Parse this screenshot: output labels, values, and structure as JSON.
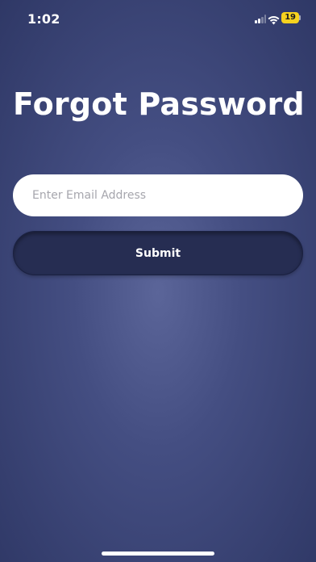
{
  "status_bar": {
    "time": "1:02",
    "battery_level": "19",
    "icons": [
      "signal-icon",
      "wifi-icon",
      "battery-icon"
    ]
  },
  "page": {
    "title": "Forgot Password"
  },
  "form": {
    "email": {
      "value": "",
      "placeholder": "Enter Email Address"
    },
    "submit_label": "Submit"
  },
  "colors": {
    "background_center": "#5b6599",
    "background_edge": "#2f3866",
    "button_background": "#262d52",
    "battery_accent": "#f6d21e"
  }
}
